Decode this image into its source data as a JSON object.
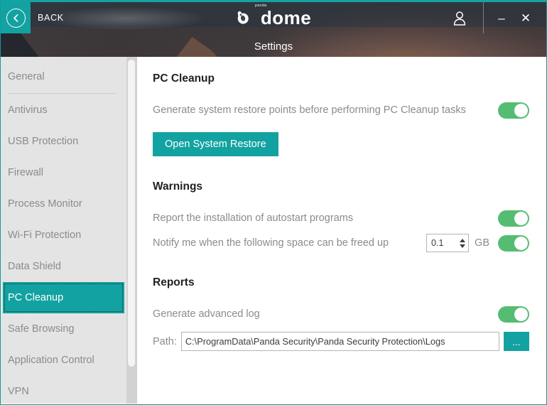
{
  "window": {
    "accent_teal": "#12a2a1",
    "toggle_green": "#55bd72",
    "back_label": "BACK",
    "page_title": "Settings",
    "logo_text": "dome",
    "logo_superscript": "panda",
    "minimize_glyph": "–",
    "close_glyph": "✕"
  },
  "sidebar": {
    "items": [
      {
        "label": "General",
        "active": false
      },
      {
        "label": "Antivirus",
        "active": false
      },
      {
        "label": "USB Protection",
        "active": false
      },
      {
        "label": "Firewall",
        "active": false
      },
      {
        "label": "Process Monitor",
        "active": false
      },
      {
        "label": "Wi-Fi Protection",
        "active": false
      },
      {
        "label": "Data Shield",
        "active": false
      },
      {
        "label": "PC Cleanup",
        "active": true
      },
      {
        "label": "Safe Browsing",
        "active": false
      },
      {
        "label": "Application Control",
        "active": false
      },
      {
        "label": "VPN",
        "active": false
      }
    ]
  },
  "content": {
    "pc_cleanup": {
      "heading": "PC Cleanup",
      "restore_points_label": "Generate system restore points before performing PC Cleanup tasks",
      "restore_points_state": "on",
      "open_system_restore_label": "Open System Restore"
    },
    "warnings": {
      "heading": "Warnings",
      "autostart_label": "Report the installation of autostart programs",
      "autostart_state": "on",
      "freed_space_label": "Notify me when the following space can be freed up",
      "freed_space_value": "0.1",
      "freed_space_unit": "GB",
      "freed_space_state": "on"
    },
    "reports": {
      "heading": "Reports",
      "advanced_log_label": "Generate advanced log",
      "advanced_log_state": "on",
      "path_label": "Path:",
      "path_value": "C:\\ProgramData\\Panda Security\\Panda Security Protection\\Logs",
      "browse_label": "..."
    }
  }
}
